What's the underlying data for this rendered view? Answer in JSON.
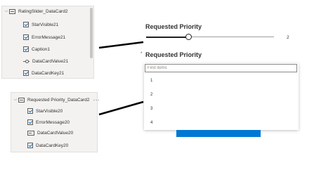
{
  "tree1": {
    "header": "RatingSlider_DataCard2",
    "items": [
      {
        "label": "StarVisible21",
        "icon": "checkbox-icon"
      },
      {
        "label": "ErrorMessage21",
        "icon": "checkbox-icon"
      },
      {
        "label": "Caption1",
        "icon": "checkbox-icon"
      },
      {
        "label": "DataCardValue21",
        "icon": "slider-icon"
      },
      {
        "label": "DataCardKey21",
        "icon": "checkbox-icon"
      }
    ]
  },
  "tree2": {
    "header": "Requested Priority_DataCard2",
    "more": "···",
    "items": [
      {
        "label": "StarVisible20",
        "icon": "checkbox-icon"
      },
      {
        "label": "ErrorMessage20",
        "icon": "checkbox-icon"
      },
      {
        "label": "DataCardValue20",
        "icon": "input-icon"
      },
      {
        "label": "DataCardKey20",
        "icon": "checkbox-icon"
      }
    ]
  },
  "slider_card": {
    "label": "Requested Priority",
    "value": "2",
    "position_fraction": 0.33
  },
  "dropdown_card": {
    "required_marker": "*",
    "label": "Requested Priority",
    "search_placeholder": "Find items",
    "options": [
      "1",
      "2",
      "3",
      "4"
    ]
  },
  "colors": {
    "accent": "#0078d4",
    "panel_bg": "#f3f2f1",
    "text": "#323130"
  }
}
